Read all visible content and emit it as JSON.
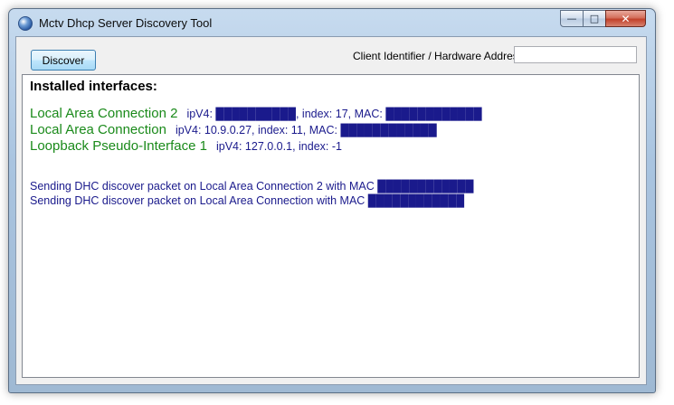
{
  "window": {
    "title": "Mctv Dhcp Server Discovery Tool",
    "controls": {
      "minimize": "—",
      "maximize": "□",
      "close": "✕"
    }
  },
  "toolbar": {
    "discover_label": "Discover",
    "client_id_label": "Client Identifier / Hardware Address",
    "client_id_value": ""
  },
  "output": {
    "heading": "Installed interfaces:",
    "interfaces": [
      {
        "name": "Local Area Connection 2",
        "details": "ipV4: ██████████, index: 17, MAC: ████████████"
      },
      {
        "name": "Local Area Connection",
        "details": "ipV4: 10.9.0.27, index: 11, MAC: ████████████"
      },
      {
        "name": "Loopback Pseudo-Interface 1",
        "details": "ipV4: 127.0.0.1, index: -1"
      }
    ],
    "messages": [
      "Sending DHC discover packet on Local Area Connection 2 with MAC ████████████",
      "Sending DHC discover packet on Local Area Connection with MAC ████████████"
    ]
  },
  "colors": {
    "interface_name": "#1a8a1a",
    "details_text": "#1a1a8c",
    "close_button": "#c2412a"
  },
  "icons": [
    "app-icon",
    "minimize-icon",
    "maximize-icon",
    "close-icon"
  ]
}
